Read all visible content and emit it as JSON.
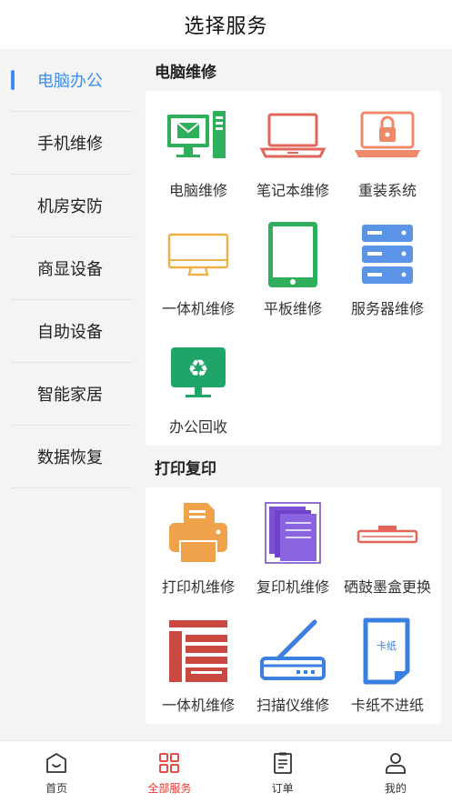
{
  "header": {
    "title": "选择服务"
  },
  "sidebar": {
    "items": [
      {
        "label": "电脑办公",
        "active": true
      },
      {
        "label": "手机维修"
      },
      {
        "label": "机房安防"
      },
      {
        "label": "商显设备"
      },
      {
        "label": "自助设备"
      },
      {
        "label": "智能家居"
      },
      {
        "label": "数据恢复"
      }
    ]
  },
  "sections": [
    {
      "title": "电脑维修",
      "items": [
        {
          "label": "电脑维修",
          "icon": "desktop-computer-icon"
        },
        {
          "label": "笔记本维修",
          "icon": "laptop-icon"
        },
        {
          "label": "重装系统",
          "icon": "laptop-lock-icon"
        },
        {
          "label": "一体机维修",
          "icon": "all-in-one-monitor-icon"
        },
        {
          "label": "平板维修",
          "icon": "tablet-icon"
        },
        {
          "label": "服务器维修",
          "icon": "server-icon"
        },
        {
          "label": "办公回收",
          "icon": "recycle-monitor-icon"
        }
      ]
    },
    {
      "title": "打印复印",
      "items": [
        {
          "label": "打印机维修",
          "icon": "printer-icon"
        },
        {
          "label": "复印机维修",
          "icon": "copier-paper-icon"
        },
        {
          "label": "硒鼓墨盒更换",
          "icon": "toner-cartridge-icon"
        },
        {
          "label": "一体机维修",
          "icon": "multifunction-printer-icon"
        },
        {
          "label": "扫描仪维修",
          "icon": "scanner-icon"
        },
        {
          "label": "卡纸不进纸",
          "icon": "paper-jam-icon",
          "icon_text": "卡纸"
        }
      ]
    }
  ],
  "tabbar": {
    "items": [
      {
        "label": "首页",
        "icon": "home-icon"
      },
      {
        "label": "全部服务",
        "icon": "grid-icon",
        "active": true
      },
      {
        "label": "订单",
        "icon": "order-icon"
      },
      {
        "label": "我的",
        "icon": "user-icon"
      }
    ]
  },
  "colors": {
    "accent_blue": "#3d8ef0",
    "active_red": "#e53935",
    "green": "#2fae5c",
    "coral": "#e2655a",
    "orange": "#f0a24a",
    "purple": "#6f42c9"
  }
}
